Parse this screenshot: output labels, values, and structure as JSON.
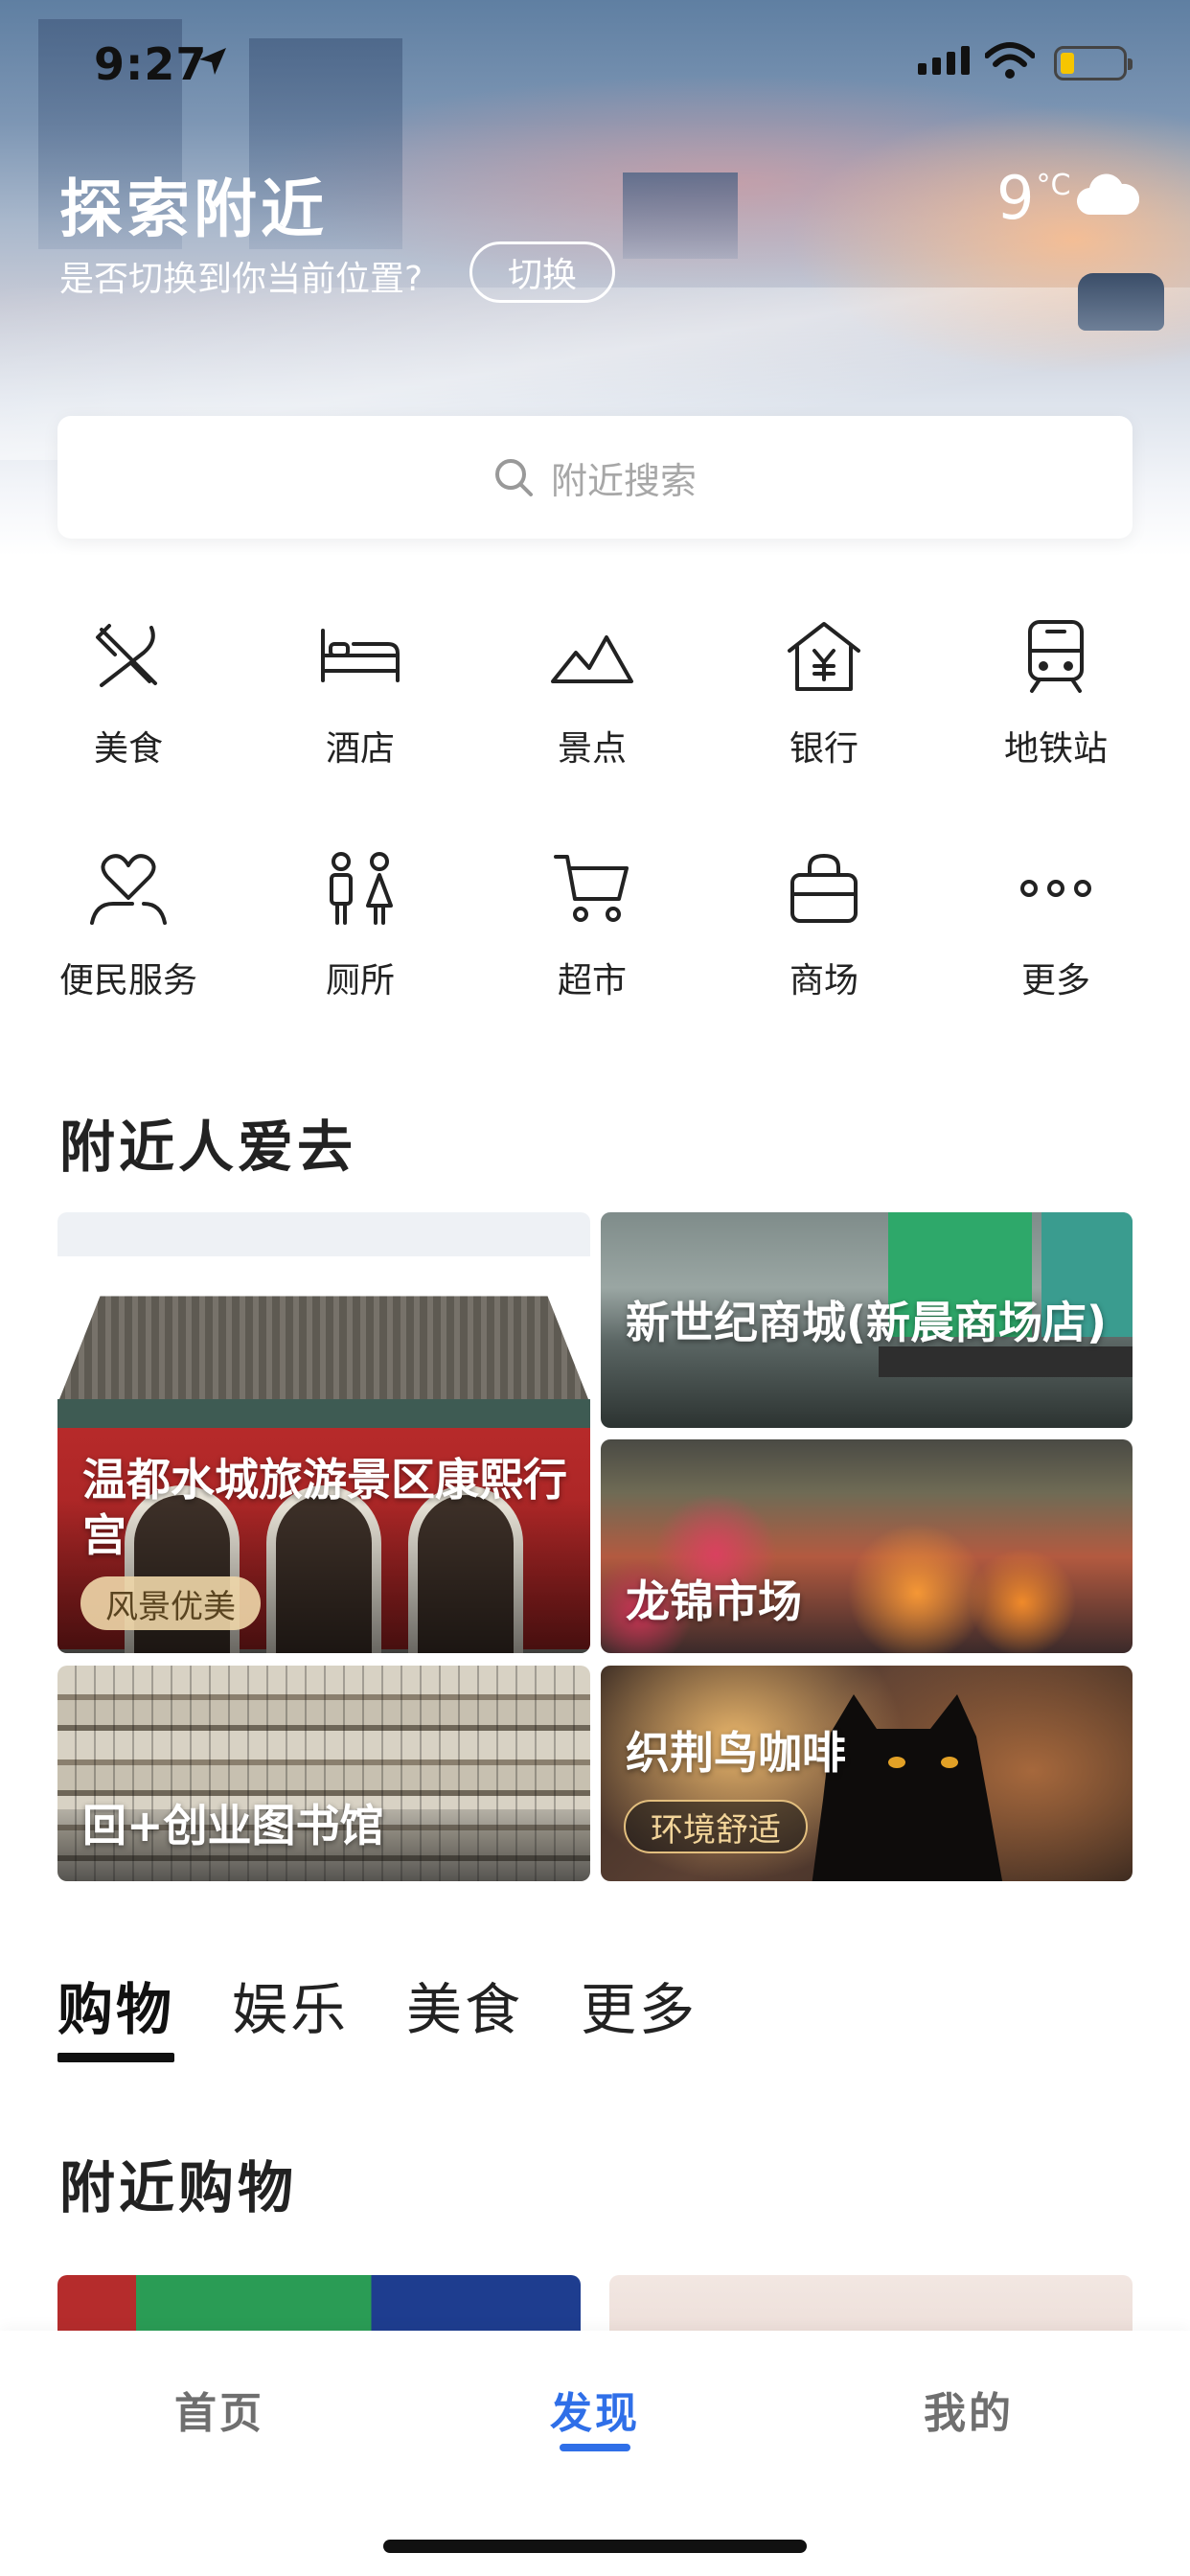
{
  "status_bar": {
    "time": "9:27"
  },
  "hero": {
    "title": "探索附近",
    "subtitle": "是否切换到你当前位置?",
    "switch_label": "切换",
    "weather": {
      "temp": "9",
      "unit": "°C",
      "icon": "cloud-icon"
    }
  },
  "search": {
    "placeholder": "附近搜索",
    "icon": "search-icon"
  },
  "categories": [
    {
      "label": "美食",
      "icon": "fork-knife-icon"
    },
    {
      "label": "酒店",
      "icon": "bed-icon"
    },
    {
      "label": "景点",
      "icon": "mountain-icon"
    },
    {
      "label": "银行",
      "icon": "bank-icon"
    },
    {
      "label": "地铁站",
      "icon": "subway-icon"
    },
    {
      "label": "便民服务",
      "icon": "heart-hand-icon"
    },
    {
      "label": "厕所",
      "icon": "restroom-icon"
    },
    {
      "label": "超市",
      "icon": "cart-icon"
    },
    {
      "label": "商场",
      "icon": "shopping-bag-icon"
    },
    {
      "label": "更多",
      "icon": "more-dots-icon"
    }
  ],
  "popular": {
    "title": "附近人爱去",
    "cards": [
      {
        "name": "温都水城旅游景区康熙行宫",
        "tag": "风景优美"
      },
      {
        "name": "新世纪商城(新晨商场店)"
      },
      {
        "name": "龙锦市场"
      },
      {
        "name": "回+创业图书馆"
      },
      {
        "name": "织荆鸟咖啡",
        "tag": "环境舒适"
      }
    ]
  },
  "tabs": [
    {
      "label": "购物",
      "active": true
    },
    {
      "label": "娱乐",
      "active": false
    },
    {
      "label": "美食",
      "active": false
    },
    {
      "label": "更多",
      "active": false
    }
  ],
  "shopping": {
    "title": "附近购物"
  },
  "bottom_nav": [
    {
      "label": "首页",
      "active": false
    },
    {
      "label": "发现",
      "active": true
    },
    {
      "label": "我的",
      "active": false
    }
  ],
  "colors": {
    "accent": "#2f6fe8",
    "tag_light": "#f0d7aa",
    "tag_dark_border": "#e3bf7e"
  }
}
